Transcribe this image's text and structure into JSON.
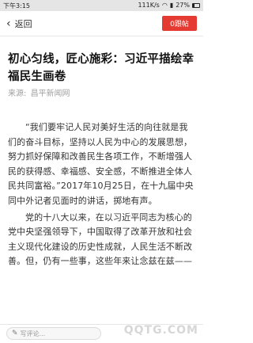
{
  "status_bar": {
    "time": "下午3:15",
    "network_speed": "111K/s",
    "battery": "27%"
  },
  "nav": {
    "back_label": "返回",
    "follow_label": "0跟帖"
  },
  "article": {
    "title": "初心匀线，匠心施彩：习近平描绘幸福民生画卷",
    "source_label": "来源:",
    "source_name": "昌平新闻网",
    "paragraphs": [
      "“我们要牢记人民对美好生活的向往就是我们的奋斗目标，坚持以人民为中心的发展思想，努力抓好保障和改善民生各项工作，不断增强人民的获得感、幸福感、安全感，不断推进全体人民共同富裕。”2017年10月25日，在十九届中央同中外记者见面时的讲话，掷地有声。",
      "党的十八大以来，在以习近平同志为核心的党中央坚强领导下，中国取得了改革开放和社会主义现代化建设的历史性成就，人民生活不断改善。但，仍有一些事，这些年来让念兹在兹——"
    ]
  },
  "comment_bar": {
    "placeholder": "写评论..."
  },
  "watermark": "QQTG.COM"
}
